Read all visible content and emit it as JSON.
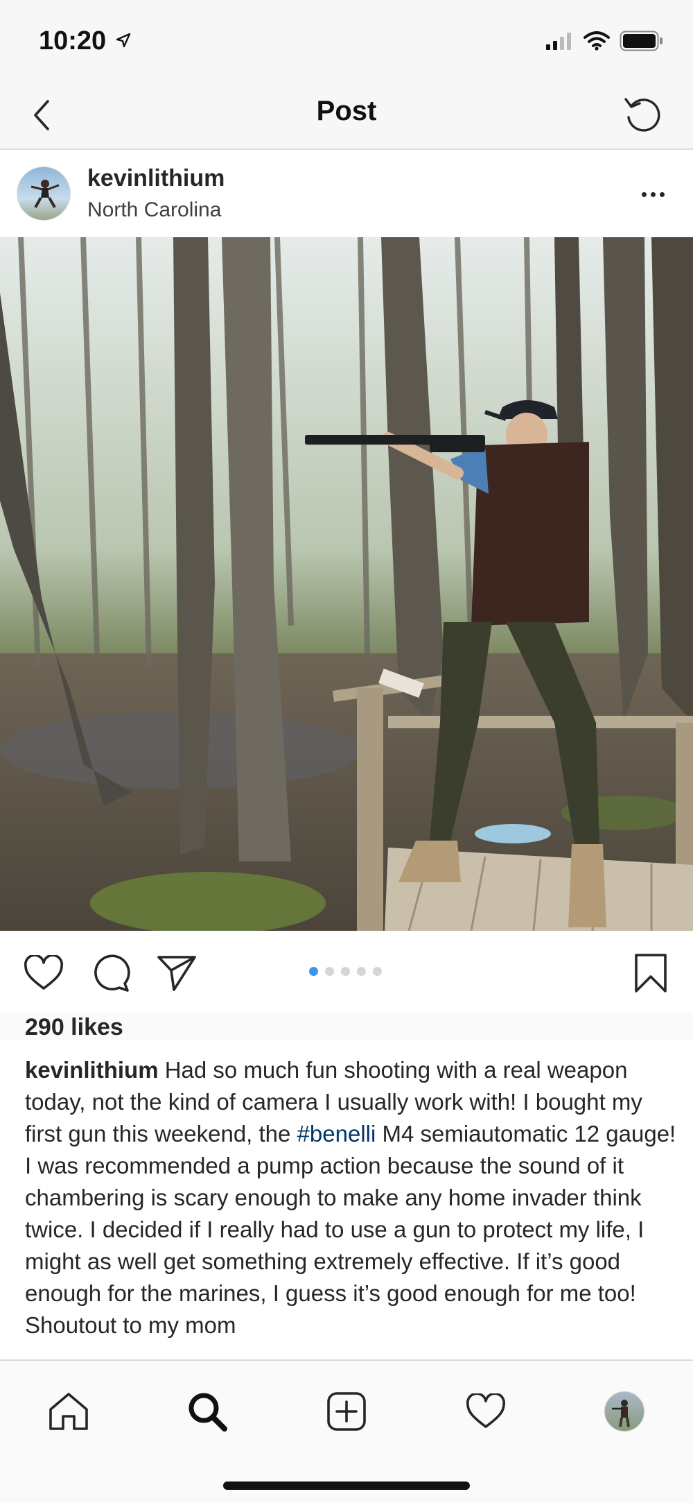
{
  "status_bar": {
    "time": "10:20"
  },
  "header": {
    "title": "Post"
  },
  "post": {
    "username": "kevinlithium",
    "location": "North Carolina",
    "likes": "290 likes",
    "carousel": {
      "count": 5,
      "active_index": 0
    },
    "caption": {
      "user": "kevinlithium",
      "text_before_hashtag": " Had so much fun shooting with a real weapon today, not the kind of camera I usually work with! I bought my first gun this weekend, the ",
      "hashtag": "#benelli",
      "text_after_hashtag": " M4 semiautomatic 12 gauge! I was recommended a pump action because the sound of it chambering is scary enough to make any home invader think twice. I decided if I really had to use a gun to protect my life, I might as well get something extremely effective. If it’s good enough for the marines, I guess it’s good enough for me too! Shoutout to my mom"
    }
  },
  "icons": {
    "back": "chevron-left-icon",
    "refresh": "refresh-icon",
    "more": "more-icon",
    "like": "heart-icon",
    "comment": "comment-icon",
    "share": "send-icon",
    "save": "bookmark-icon"
  },
  "tab_bar": [
    "home",
    "search",
    "new-post",
    "activity",
    "profile"
  ],
  "colors": {
    "hashtag": "#003569",
    "carousel_active": "#3897f0"
  }
}
